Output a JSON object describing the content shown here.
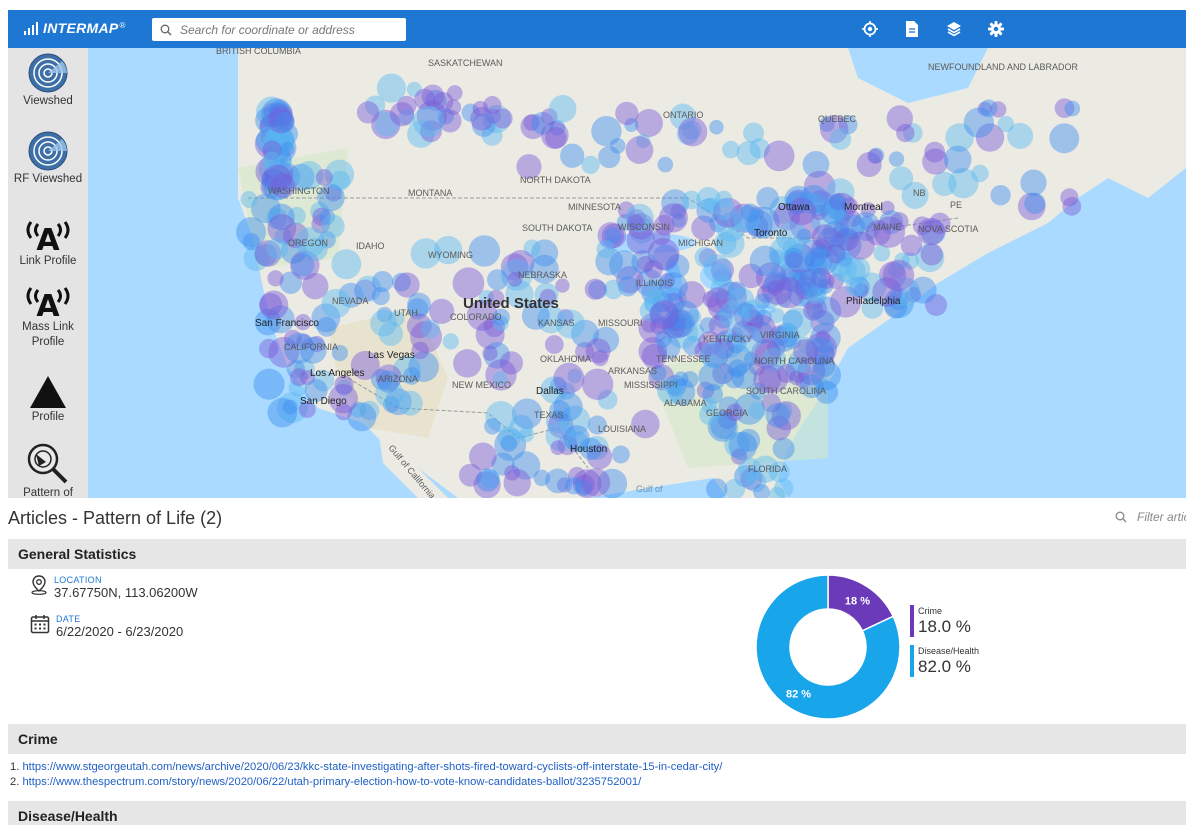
{
  "app": {
    "logo_text": "INTERMAP",
    "logo_registered": "®",
    "search_placeholder": "Search for coordinate or address",
    "toolbar_icons": [
      "locate-icon",
      "document-icon",
      "layers-icon",
      "settings-icon"
    ]
  },
  "sidebar": {
    "tools": [
      {
        "id": "viewshed",
        "label": "Viewshed",
        "icon": "viewshed-icon"
      },
      {
        "id": "rf-viewshed",
        "label": "RF Viewshed",
        "icon": "rf-viewshed-icon"
      },
      {
        "id": "link-profile",
        "label": "Link Profile",
        "icon": "antenna-icon"
      },
      {
        "id": "mass-link-profile",
        "label": "Mass Link Profile",
        "icon": "antenna-icon"
      },
      {
        "id": "profile",
        "label": "Profile",
        "icon": "mountain-icon"
      },
      {
        "id": "pattern-of-life",
        "label": "Pattern of",
        "icon": "magnifier-icon"
      }
    ]
  },
  "map": {
    "labels": {
      "british_columbia": "BRITISH COLUMBIA",
      "saskatchewan": "SASKATCHEWAN",
      "newfoundland": "NEWFOUNDLAND AND LABRADOR",
      "ontario": "ONTARIO",
      "quebec": "QUEBEC",
      "washington": "WASHINGTON",
      "montana": "MONTANA",
      "north_dakota": "NORTH DAKOTA",
      "minnesota": "MINNESOTA",
      "ottawa": "Ottawa",
      "montreal": "Montreal",
      "nb": "NB",
      "pe": "PE",
      "maine": "MAINE",
      "nova_scotia": "NOVA SCOTIA",
      "oregon": "OREGON",
      "idaho": "IDAHO",
      "wyoming": "WYOMING",
      "south_dakota": "SOUTH DAKOTA",
      "wisconsin": "WISCONSIN",
      "michigan": "MICHIGAN",
      "toronto": "Toronto",
      "nebraska": "NEBRASKA",
      "illinois": "ILLINOIS",
      "united_states": "United States",
      "nevada": "NEVADA",
      "utah": "UTAH",
      "colorado": "COLORADO",
      "kansas": "KANSAS",
      "missouri": "MISSOURI",
      "san_francisco": "San Francisco",
      "philadelphia": "Philadelphia",
      "california": "CALIFORNIA",
      "las_vegas": "Las Vegas",
      "oklahoma": "OKLAHOMA",
      "kentucky": "KENTUCKY",
      "virginia": "VIRGINIA",
      "tennessee": "TENNESSEE",
      "north_carolina": "NORTH CAROLINA",
      "los_angeles": "Los Angeles",
      "arizona": "ARIZONA",
      "new_mexico": "NEW MEXICO",
      "dallas": "Dallas",
      "arkansas": "ARKANSAS",
      "mississippi": "MISSISSIPPI",
      "south_carolina": "SOUTH CAROLINA",
      "san_diego": "San Diego",
      "texas": "TEXAS",
      "alabama": "ALABAMA",
      "georgia": "GEORGIA",
      "gulf_of_california": "Gulf of California",
      "houston": "Houston",
      "louisiana": "LOUISIANA",
      "gulf_of_mexico": "Gulf of",
      "florida": "FLORIDA"
    }
  },
  "articles": {
    "title": "Articles - Pattern of Life (2)",
    "filter_placeholder": "Filter articles"
  },
  "general_statistics": {
    "heading": "General Statistics",
    "location_label": "LOCATION",
    "location_value": "37.67750N, 113.06200W",
    "date_label": "DATE",
    "date_value": "6/22/2020 - 6/23/2020"
  },
  "chart_data": {
    "type": "pie",
    "categories": [
      "Crime",
      "Disease/Health"
    ],
    "values": [
      18.0,
      82.0
    ],
    "slice_labels": [
      "18 %",
      "82 %"
    ],
    "legend_values": [
      "18.0 %",
      "82.0 %"
    ],
    "colors": [
      "#6a3ab8",
      "#19a5ea"
    ],
    "legend": "right"
  },
  "crime": {
    "heading": "Crime",
    "links": [
      {
        "num": "1.",
        "url": "https://www.stgeorgeutah.com/news/archive/2020/06/23/kkc-state-investigating-after-shots-fired-toward-cyclists-off-interstate-15-in-cedar-city/"
      },
      {
        "num": "2.",
        "url": "https://www.thespectrum.com/story/news/2020/06/22/utah-primary-election-how-to-vote-know-candidates-ballot/3235752001/"
      }
    ]
  },
  "disease_health": {
    "heading": "Disease/Health"
  },
  "colors": {
    "brand_blue": "#1f77d4",
    "crime": "#6a3ab8",
    "disease": "#19a5ea",
    "water": "#aadaff",
    "land": "#ecebe3"
  }
}
